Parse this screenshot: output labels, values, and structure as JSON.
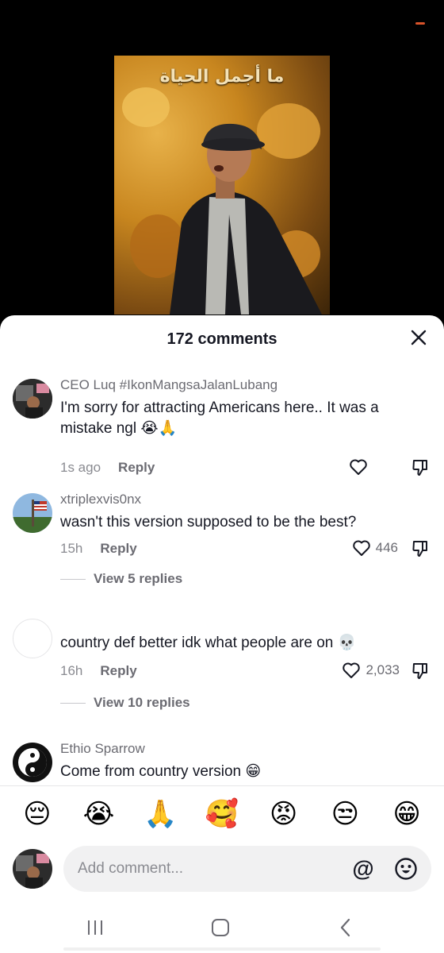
{
  "video": {
    "overlay_text": "ما أجمل الحياة"
  },
  "comments_sheet": {
    "title": "172 comments",
    "comments": [
      {
        "username": "CEO Luq #IkonMangsaJalanLubang",
        "text": "I'm sorry for attracting Americans here.. It was a mistake ngl 😭🙏",
        "time": "1s ago",
        "reply_label": "Reply",
        "likes": ""
      },
      {
        "username": "xtriplexvis0nx",
        "text": "wasn't this version supposed to be the best?",
        "time": "15h",
        "reply_label": "Reply",
        "likes": "446",
        "view_replies": "View 5 replies"
      },
      {
        "username": "",
        "text": "country def better idk what people are on 💀",
        "time": "16h",
        "reply_label": "Reply",
        "likes": "2,033",
        "view_replies": "View 10 replies"
      },
      {
        "username": "Ethio Sparrow",
        "text": "Come from country version 😁"
      }
    ],
    "quick_emojis": [
      "😔",
      "😭",
      "🙏",
      "🥰",
      "😡",
      "😒",
      "😁"
    ],
    "input": {
      "placeholder": "Add comment...",
      "mention_symbol": "@"
    }
  },
  "icons": {
    "close": "close-icon",
    "like": "heart-icon",
    "dislike": "thumbs-down-icon",
    "emoji_picker": "smiley-icon",
    "nav": [
      "recent-apps-icon",
      "home-icon",
      "back-icon"
    ]
  },
  "colors": {
    "primary_text": "#161823",
    "secondary_text": "#6b6b72",
    "sheet_bg": "#ffffff",
    "input_bg": "#f1f1f2"
  }
}
